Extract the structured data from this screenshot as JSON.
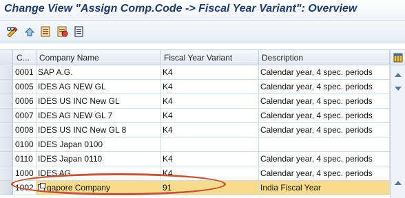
{
  "window": {
    "title": "Change View \"Assign Comp.Code -> Fiscal Year Variant\": Overview"
  },
  "toolbar": {
    "buttons": [
      {
        "icon": "edit-glasses-icon"
      },
      {
        "icon": "undo-icon"
      },
      {
        "icon": "copy-entries-icon"
      },
      {
        "icon": "delete-entries-icon"
      },
      {
        "icon": "details-icon"
      }
    ]
  },
  "table": {
    "columns": {
      "code": "C...",
      "company": "Company Name",
      "variant": "Fiscal Year Variant",
      "description": "Description"
    },
    "rows": [
      {
        "code": "0001",
        "company": "SAP A.G.",
        "variant": "K4",
        "description": "Calendar year, 4 spec. periods"
      },
      {
        "code": "0005",
        "company": "IDES AG NEW GL",
        "variant": "K4",
        "description": "Calendar year, 4 spec. periods"
      },
      {
        "code": "0006",
        "company": "IDES US INC New GL",
        "variant": "K4",
        "description": "Calendar year, 4 spec. periods"
      },
      {
        "code": "0007",
        "company": "IDES AG NEW GL 7",
        "variant": "K4",
        "description": "Calendar year, 4 spec. periods"
      },
      {
        "code": "0008",
        "company": "IDES US INC New GL 8",
        "variant": "K4",
        "description": "Calendar year, 4 spec. periods"
      },
      {
        "code": "0100",
        "company": "IDES Japan 0100",
        "variant": "",
        "description": ""
      },
      {
        "code": "0110",
        "company": "IDES Japan 0110",
        "variant": "K4",
        "description": "Calendar year, 4 spec. periods"
      },
      {
        "code": "1000",
        "company": "IDES AG",
        "variant": "K4",
        "description": "Calendar year, 4 spec. periods"
      },
      {
        "code": "1002",
        "company": "gapore Company",
        "variant": "91",
        "description": "India Fiscal Year",
        "highlight": true
      }
    ]
  },
  "colors": {
    "title": "#1f3b66",
    "highlight_row": "#f8dc8c",
    "callout": "#c0553a"
  }
}
